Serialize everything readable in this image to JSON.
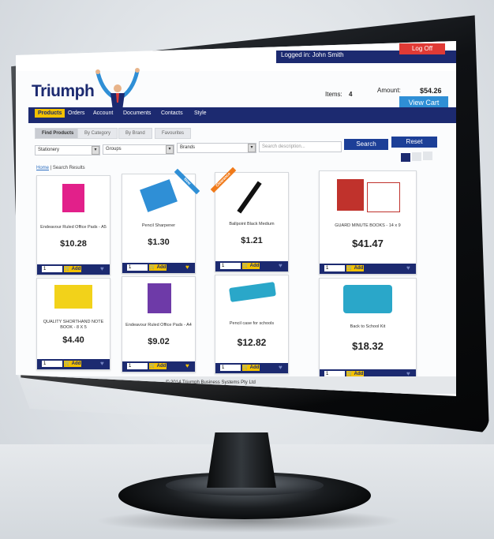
{
  "header": {
    "logged_in_label": "Logged in:",
    "user_name": "John Smith",
    "logoff_label": "Log Off",
    "brand": "Triumph",
    "items_label": "Items:",
    "items_value": "4",
    "amount_label": "Amount:",
    "amount_value": "$54.26",
    "view_cart_label": "View Cart"
  },
  "nav": {
    "items": [
      "Products",
      "Orders",
      "Account",
      "Documents",
      "Contacts",
      "Style"
    ],
    "active": "Products"
  },
  "subtabs": {
    "items": [
      "Find Products",
      "By Category",
      "By Brand",
      "Favourites"
    ],
    "active": "Find Products"
  },
  "filters": {
    "category": "Stationery",
    "groups": "Groups",
    "brands": "Brands",
    "search_placeholder": "Search description...",
    "search_label": "Search",
    "reset_label": "Reset"
  },
  "breadcrumb": {
    "home": "Home",
    "current": "Search Results"
  },
  "products": [
    {
      "name": "Endeavour Ruled Office Pads - A5",
      "price": "$10.28",
      "qty": "1",
      "add": "Add",
      "ribbon": "",
      "fav": false
    },
    {
      "name": "Pencil Sharpener",
      "price": "$1.30",
      "qty": "1",
      "add": "Add",
      "ribbon": "New",
      "fav": true
    },
    {
      "name": "Ballpoint Black Medium",
      "price": "$1.21",
      "qty": "1",
      "add": "Add",
      "ribbon": "Clearance",
      "fav": false
    },
    {
      "name": "GUARD MINUTE BOOKS - 14 x 9",
      "price": "$41.47",
      "qty": "1",
      "add": "Add",
      "ribbon": "",
      "fav": false
    },
    {
      "name": "QUALITY SHORTHAND NOTE BOOK - 8 X 5",
      "price": "$4.40",
      "qty": "1",
      "add": "Add",
      "ribbon": "",
      "fav": false
    },
    {
      "name": "Endeavour Ruled Office Pads - A4",
      "price": "$9.02",
      "qty": "1",
      "add": "Add",
      "ribbon": "",
      "fav": true
    },
    {
      "name": "Pencil case for schools",
      "price": "$12.82",
      "qty": "1",
      "add": "Add",
      "ribbon": "",
      "fav": false
    },
    {
      "name": "Back to School Kit",
      "price": "$18.32",
      "qty": "1",
      "add": "Add",
      "ribbon": "",
      "fav": false
    }
  ],
  "footer": {
    "text": "© 2014 Triumph Business Systems Pty Ltd"
  },
  "colors": {
    "navy": "#1c2a70",
    "accent_yellow": "#f2c100",
    "logoff_red": "#e03a35",
    "cart_blue": "#2f8fd6"
  }
}
